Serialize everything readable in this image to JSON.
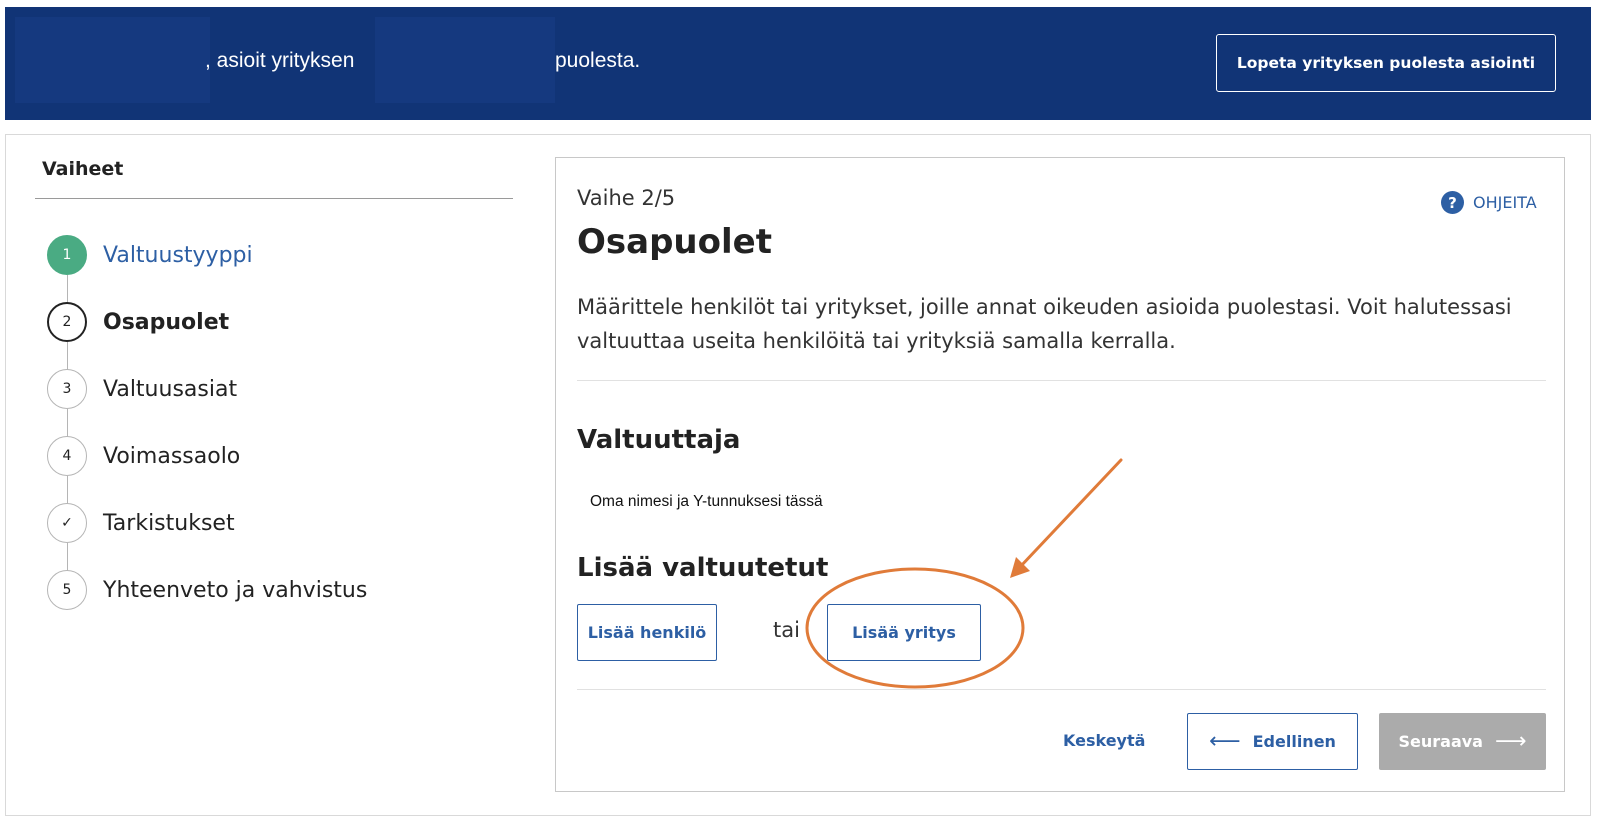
{
  "banner": {
    "text_part1": ", asioit yrityksen",
    "text_part2": "puolesta.",
    "stop_button": "Lopeta yrityksen puolesta asiointi"
  },
  "sidebar": {
    "title": "Vaiheet",
    "steps": [
      {
        "marker": "1",
        "label": "Valtuustyyppi",
        "state": "completed"
      },
      {
        "marker": "2",
        "label": "Osapuolet",
        "state": "current"
      },
      {
        "marker": "3",
        "label": "Valtuusasiat",
        "state": "upcoming"
      },
      {
        "marker": "4",
        "label": "Voimassaolo",
        "state": "upcoming"
      },
      {
        "marker": "✓",
        "label": "Tarkistukset",
        "state": "upcoming"
      },
      {
        "marker": "5",
        "label": "Yhteenveto ja vahvistus",
        "state": "upcoming"
      }
    ]
  },
  "main": {
    "phase": "Vaihe 2/5",
    "help_label": "OHJEITA",
    "title": "Osapuolet",
    "intro": "Määrittele henkilöt tai yritykset, joille annat oikeuden asioida puolestasi. Voit halutessasi valtuuttaa useita henkilöitä tai yrityksiä samalla kerralla.",
    "granter_heading": "Valtuuttaja",
    "granter_note": "Oma nimesi ja Y-tunnuksesi tässä",
    "add_heading": "Lisää valtuutetut",
    "add_person_label": "Lisää henkilö",
    "or_label": "tai",
    "add_company_label": "Lisää yritys"
  },
  "footer": {
    "cancel_label": "Keskeytä",
    "prev_label": "Edellinen",
    "next_label": "Seuraava"
  },
  "colors": {
    "banner": "#113476",
    "link": "#2d5fa4",
    "step_done": "#4aab83",
    "annotation": "#e07b39",
    "disabled_button": "#ababab"
  }
}
